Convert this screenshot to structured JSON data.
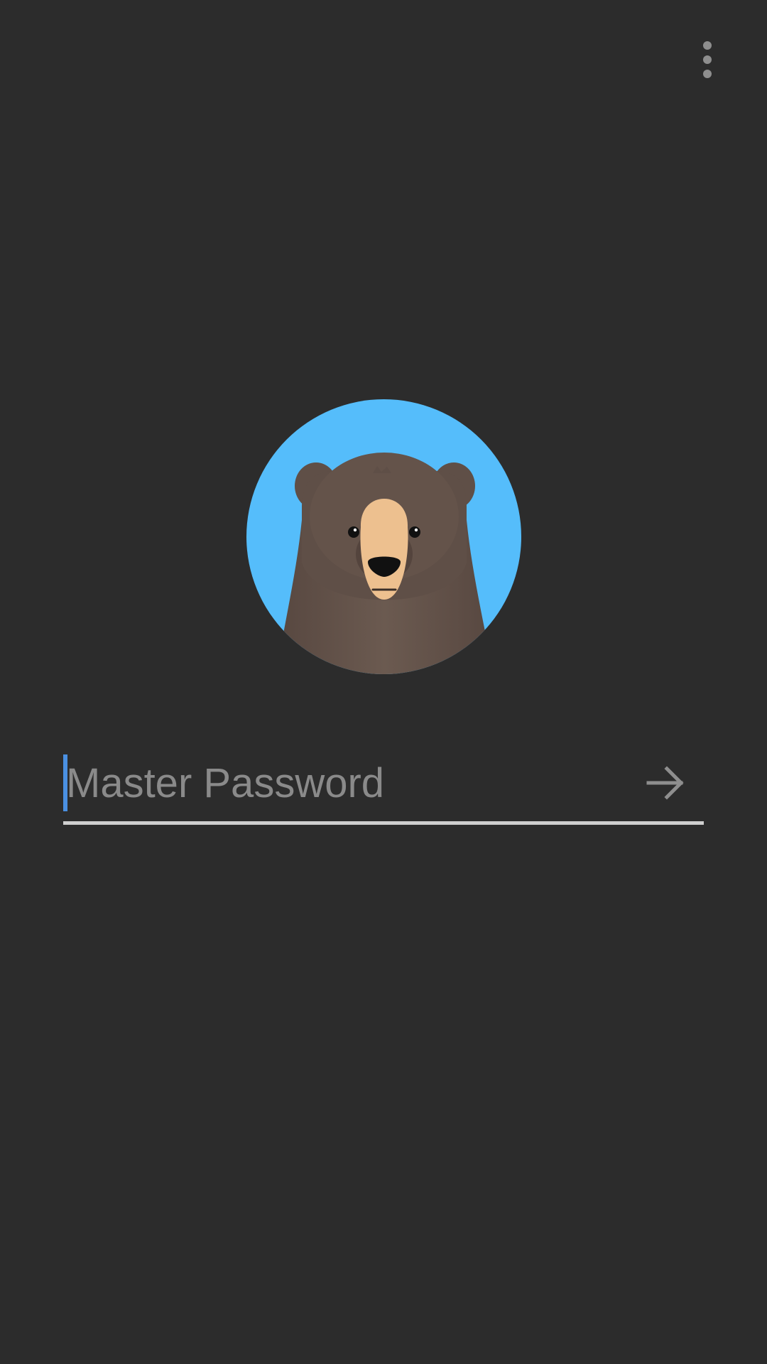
{
  "header": {
    "menu_icon": "more-vert-icon"
  },
  "logo": {
    "icon": "bear-logo",
    "background_color": "#55bdfb",
    "fur_color": "#5f4f47",
    "snout_color": "#edc08f"
  },
  "login": {
    "password_placeholder": "Master Password",
    "password_value": "",
    "submit_icon": "arrow-right-icon"
  },
  "colors": {
    "background": "#2c2c2c",
    "caret": "#4a90e2",
    "underline": "#cfcfcf",
    "icon": "#8e8e8e"
  }
}
